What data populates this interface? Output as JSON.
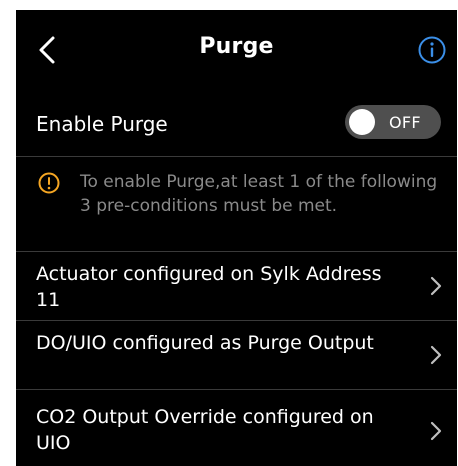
{
  "header": {
    "back_icon": "chevron-left-icon",
    "title": "Purge",
    "info_icon": "info-circle-icon"
  },
  "enable": {
    "label": "Enable Purge",
    "toggle_state": "OFF"
  },
  "notice": {
    "icon": "warning-circle-icon",
    "text": "To enable Purge,at least 1 of the following 3 pre-conditions must be met."
  },
  "conditions": [
    {
      "label": "Actuator configured on Sylk Address 11",
      "icon": "chevron-right-icon"
    },
    {
      "label": "DO/UIO configured as Purge Output",
      "icon": "chevron-right-icon"
    },
    {
      "label": "CO2 Output Override configured on UIO",
      "icon": "chevron-right-icon"
    }
  ],
  "colors": {
    "background": "#000000",
    "accent_info": "#3b8fe8",
    "warning": "#f5a623",
    "muted_text": "#8a8a8a",
    "toggle_track": "#4f4f4f"
  }
}
